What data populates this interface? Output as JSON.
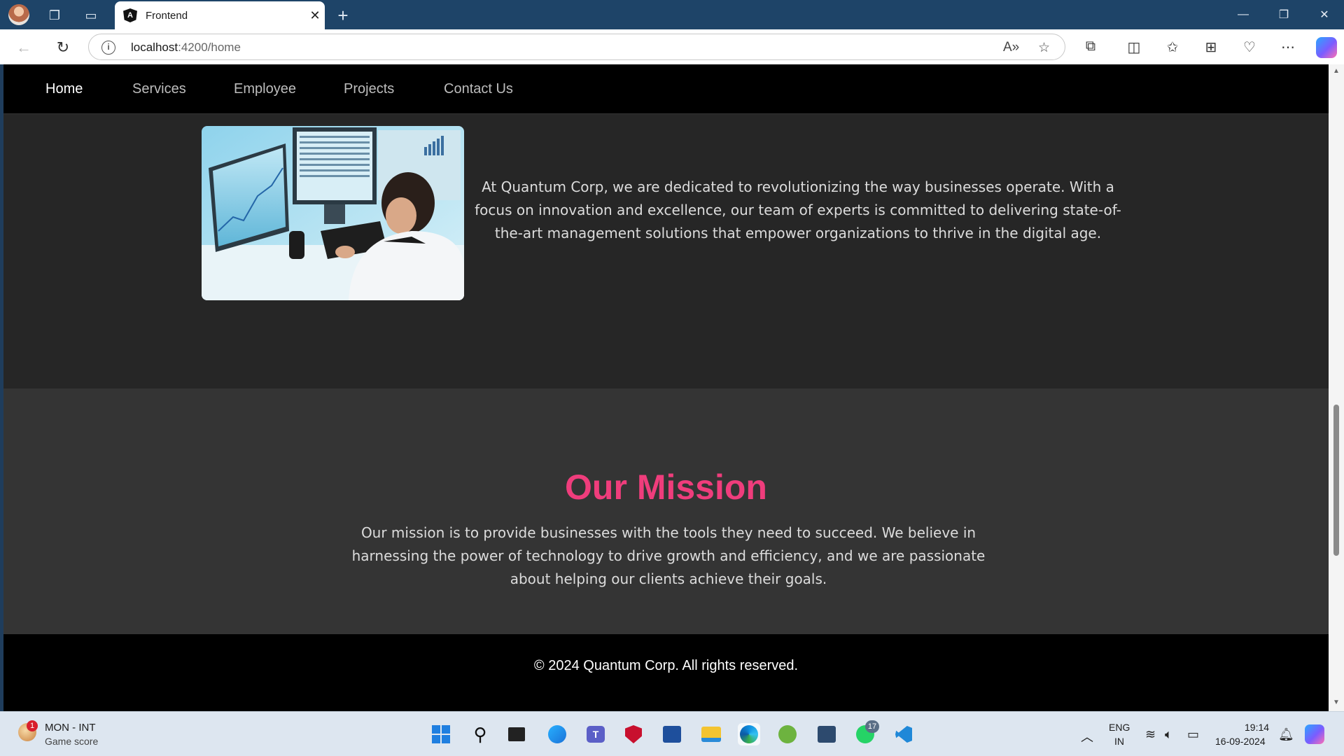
{
  "browser": {
    "tab_title": "Frontend",
    "tab_logo": "A",
    "url_host": "localhost",
    "url_path": ":4200/home",
    "new_tab_glyph": "+",
    "close_glyph": "✕"
  },
  "site": {
    "nav": [
      {
        "label": "Home",
        "active": true
      },
      {
        "label": "Services",
        "active": false
      },
      {
        "label": "Employee",
        "active": false
      },
      {
        "label": "Projects",
        "active": false
      },
      {
        "label": "Contact Us",
        "active": false
      }
    ],
    "about_text": "At Quantum Corp, we are dedicated to revolutionizing the way businesses operate. With a focus on innovation and excellence, our team of experts is committed to delivering state-of-the-art management solutions that empower organizations to thrive in the digital age.",
    "mission_title": "Our Mission",
    "mission_text": "Our mission is to provide businesses with the tools they need to succeed. We believe in harnessing the power of technology to drive growth and efficiency, and we are passionate about helping our clients achieve their goals.",
    "footer_text": "© 2024 Quantum Corp. All rights reserved."
  },
  "taskbar": {
    "widget_title": "MON - INT",
    "widget_subtitle": "Game score",
    "widget_badge": "1",
    "whatsapp_badge": "17",
    "lang_top": "ENG",
    "lang_bottom": "IN",
    "time": "19:14",
    "date": "16-09-2024"
  },
  "colors": {
    "accent_pink": "#ef3d7c",
    "page_bg": "#262626",
    "mission_bg": "#343434",
    "nav_bg": "#000000"
  }
}
